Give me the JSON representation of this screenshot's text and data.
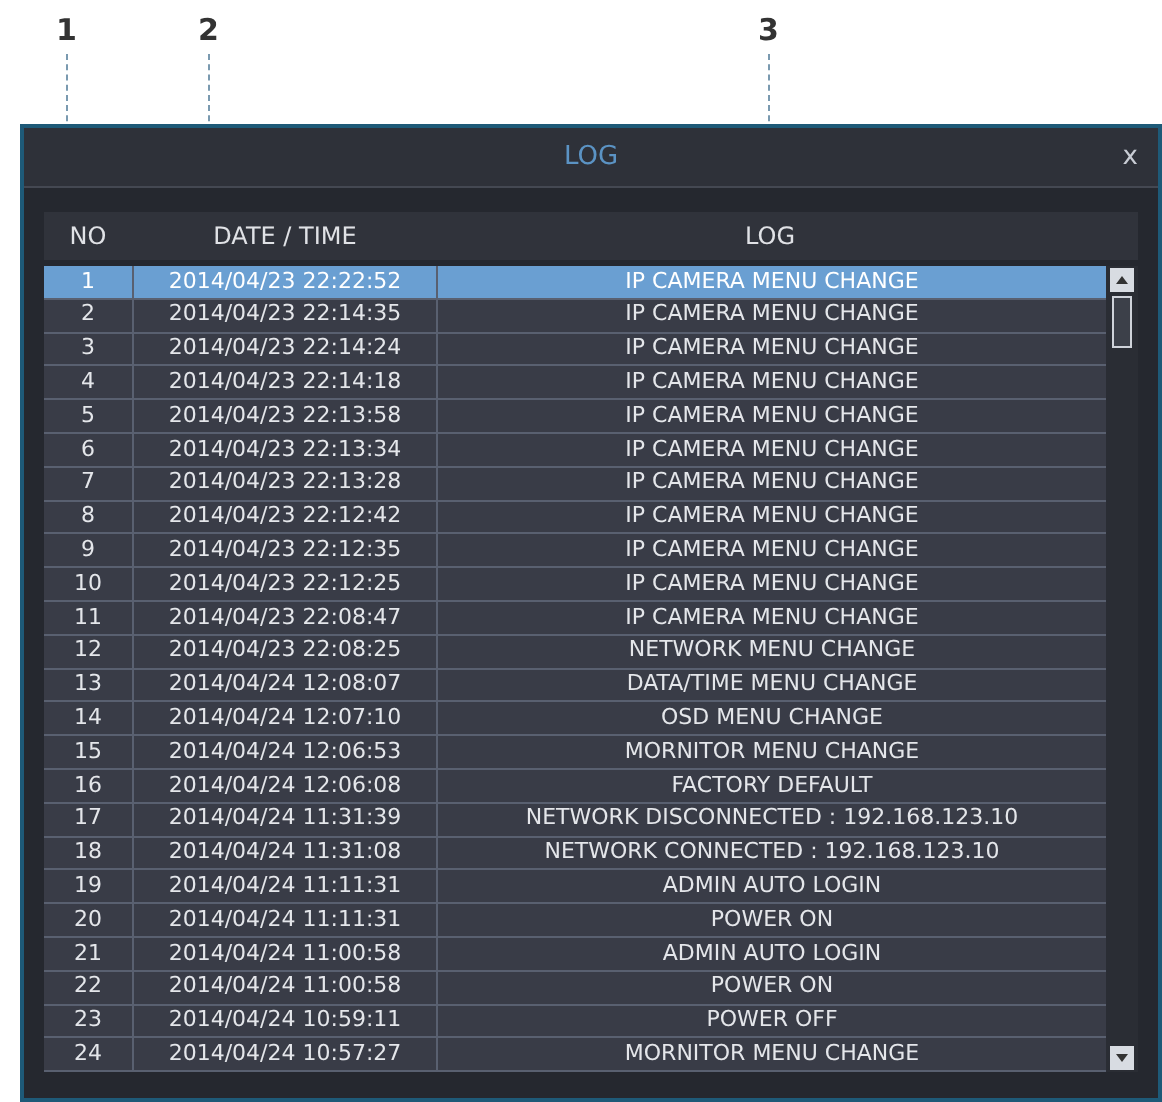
{
  "callouts": [
    "1",
    "2",
    "3"
  ],
  "window": {
    "title": "LOG",
    "close": "x"
  },
  "table": {
    "columns": [
      "NO",
      "DATE / TIME",
      "LOG"
    ],
    "rows": [
      {
        "no": "1",
        "datetime": "2014/04/23 22:22:52",
        "log": "IP CAMERA MENU CHANGE",
        "selected": true
      },
      {
        "no": "2",
        "datetime": "2014/04/23 22:14:35",
        "log": "IP CAMERA MENU CHANGE",
        "selected": false
      },
      {
        "no": "3",
        "datetime": "2014/04/23 22:14:24",
        "log": "IP CAMERA MENU CHANGE",
        "selected": false
      },
      {
        "no": "4",
        "datetime": "2014/04/23 22:14:18",
        "log": "IP CAMERA MENU CHANGE",
        "selected": false
      },
      {
        "no": "5",
        "datetime": "2014/04/23 22:13:58",
        "log": "IP CAMERA MENU CHANGE",
        "selected": false
      },
      {
        "no": "6",
        "datetime": "2014/04/23 22:13:34",
        "log": "IP CAMERA MENU CHANGE",
        "selected": false
      },
      {
        "no": "7",
        "datetime": "2014/04/23 22:13:28",
        "log": "IP CAMERA MENU CHANGE",
        "selected": false
      },
      {
        "no": "8",
        "datetime": "2014/04/23 22:12:42",
        "log": "IP CAMERA MENU CHANGE",
        "selected": false
      },
      {
        "no": "9",
        "datetime": "2014/04/23 22:12:35",
        "log": "IP CAMERA MENU CHANGE",
        "selected": false
      },
      {
        "no": "10",
        "datetime": "2014/04/23 22:12:25",
        "log": "IP CAMERA MENU CHANGE",
        "selected": false
      },
      {
        "no": "11",
        "datetime": "2014/04/23 22:08:47",
        "log": "IP CAMERA MENU CHANGE",
        "selected": false
      },
      {
        "no": "12",
        "datetime": "2014/04/23 22:08:25",
        "log": "NETWORK MENU CHANGE",
        "selected": false
      },
      {
        "no": "13",
        "datetime": "2014/04/24 12:08:07",
        "log": "DATA/TIME MENU CHANGE",
        "selected": false
      },
      {
        "no": "14",
        "datetime": "2014/04/24 12:07:10",
        "log": "OSD MENU CHANGE",
        "selected": false
      },
      {
        "no": "15",
        "datetime": "2014/04/24 12:06:53",
        "log": "MORNITOR MENU CHANGE",
        "selected": false
      },
      {
        "no": "16",
        "datetime": "2014/04/24 12:06:08",
        "log": "FACTORY DEFAULT",
        "selected": false
      },
      {
        "no": "17",
        "datetime": "2014/04/24 11:31:39",
        "log": "NETWORK DISCONNECTED : 192.168.123.10",
        "selected": false
      },
      {
        "no": "18",
        "datetime": "2014/04/24 11:31:08",
        "log": "NETWORK CONNECTED : 192.168.123.10",
        "selected": false
      },
      {
        "no": "19",
        "datetime": "2014/04/24 11:11:31",
        "log": "ADMIN AUTO LOGIN",
        "selected": false
      },
      {
        "no": "20",
        "datetime": "2014/04/24 11:11:31",
        "log": "POWER ON",
        "selected": false
      },
      {
        "no": "21",
        "datetime": "2014/04/24 11:00:58",
        "log": "ADMIN AUTO LOGIN",
        "selected": false
      },
      {
        "no": "22",
        "datetime": "2014/04/24 11:00:58",
        "log": "POWER ON",
        "selected": false
      },
      {
        "no": "23",
        "datetime": "2014/04/24 10:59:11",
        "log": "POWER OFF",
        "selected": false
      },
      {
        "no": "24",
        "datetime": "2014/04/24 10:57:27",
        "log": "MORNITOR MENU CHANGE",
        "selected": false
      }
    ]
  }
}
